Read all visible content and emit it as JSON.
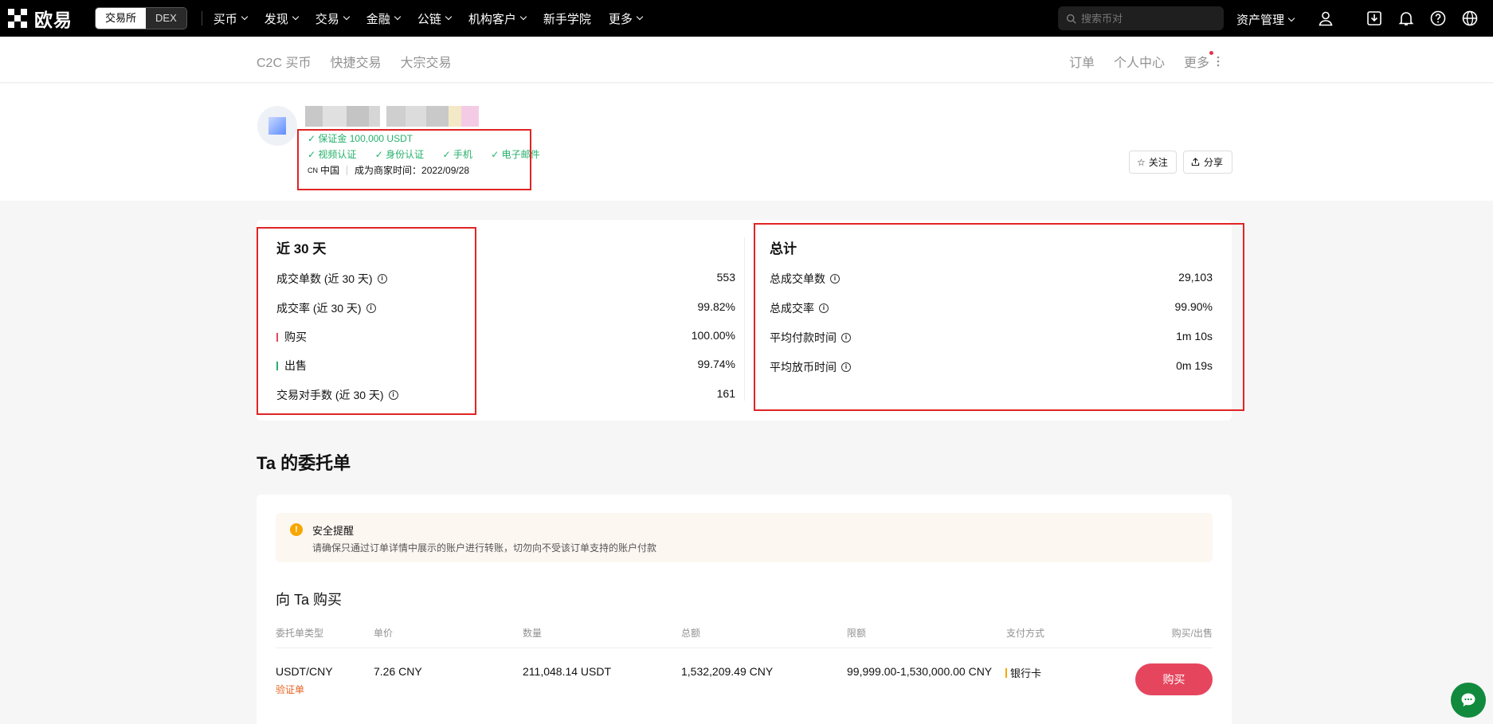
{
  "topnav": {
    "logo_text": "欧易",
    "mode_exchange": "交易所",
    "mode_dex": "DEX",
    "items": [
      "买币",
      "发现",
      "交易",
      "金融",
      "公链",
      "机构客户",
      "新手学院",
      "更多"
    ],
    "search_placeholder": "搜索币对",
    "assets": "资产管理",
    "icons": [
      "user-icon",
      "download-icon",
      "bell-icon",
      "help-icon",
      "globe-icon"
    ]
  },
  "subnav": {
    "left": [
      "C2C 买币",
      "快捷交易",
      "大宗交易"
    ],
    "right": [
      "订单",
      "个人中心",
      "更多"
    ]
  },
  "merchant": {
    "deposit": "保证金 100,000 USDT",
    "verifications": [
      "视频认证",
      "身份认证",
      "手机",
      "电子邮件"
    ],
    "country_code": "CN",
    "country": "中国",
    "since": "成为商家时间：2022/09/28",
    "follow": "关注",
    "share": "分享"
  },
  "stats30": {
    "title": "近 30 天",
    "rows": [
      {
        "label": "成交单数 (近 30 天)",
        "value": "553"
      },
      {
        "label": "成交率 (近 30 天)",
        "value": "99.82%"
      },
      {
        "label": "购买",
        "value": "100.00%"
      },
      {
        "label": "出售",
        "value": "99.74%"
      },
      {
        "label": "交易对手数 (近 30 天)",
        "value": "161"
      }
    ]
  },
  "statsTotal": {
    "title": "总计",
    "rows": [
      {
        "label": "总成交单数",
        "value": "29,103"
      },
      {
        "label": "总成交率",
        "value": "99.90%"
      },
      {
        "label": "平均付款时间",
        "value": "1m 10s"
      },
      {
        "label": "平均放币时间",
        "value": "0m 19s"
      }
    ]
  },
  "orders": {
    "title": "Ta 的委托单",
    "alert_title": "安全提醒",
    "alert_text": "请确保只通过订单详情中展示的账户进行转账，切勿向不受该订单支持的账户付款",
    "buy_heading": "向 Ta 购买",
    "columns": [
      "委托单类型",
      "单价",
      "数量",
      "总额",
      "限额",
      "支付方式",
      "购买/出售"
    ],
    "row": {
      "pair": "USDT/CNY",
      "tag": "验证单",
      "price": "7.26 CNY",
      "amount": "211,048.14 USDT",
      "total": "1,532,209.49 CNY",
      "limit": "99,999.00-1,530,000.00 CNY",
      "payment": "银行卡",
      "action": "购买"
    }
  },
  "colors": {
    "green": "#25b06b",
    "buy_red": "#e5465e",
    "highlight_red": "#e02424",
    "warning": "#f7a600"
  }
}
